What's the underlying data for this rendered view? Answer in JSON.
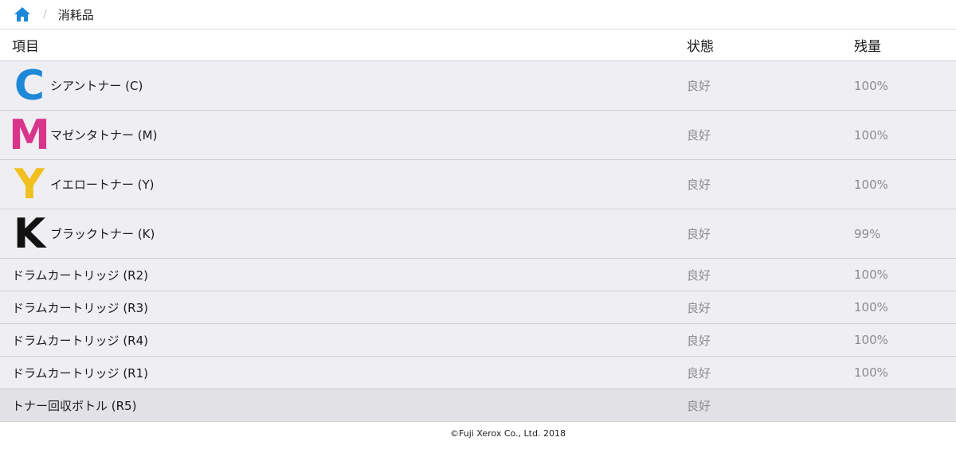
{
  "breadcrumb": {
    "home_icon": "home-icon",
    "separator": "/",
    "current": "消耗品"
  },
  "table": {
    "headers": {
      "item": "項目",
      "status": "状態",
      "level": "残量"
    },
    "rows": [
      {
        "letter": "C",
        "letter_color": "#1e88d8",
        "label": "シアントナー (C)",
        "status": "良好",
        "level": "100%"
      },
      {
        "letter": "M",
        "letter_color": "#d8358a",
        "label": "マゼンタトナー (M)",
        "status": "良好",
        "level": "100%"
      },
      {
        "letter": "Y",
        "letter_color": "#f0c020",
        "label": "イエロートナー (Y)",
        "status": "良好",
        "level": "100%"
      },
      {
        "letter": "K",
        "letter_color": "#111111",
        "label": "ブラックトナー (K)",
        "status": "良好",
        "level": "99%"
      },
      {
        "label": "ドラムカートリッジ (R2)",
        "status": "良好",
        "level": "100%"
      },
      {
        "label": "ドラムカートリッジ (R3)",
        "status": "良好",
        "level": "100%"
      },
      {
        "label": "ドラムカートリッジ (R4)",
        "status": "良好",
        "level": "100%"
      },
      {
        "label": "ドラムカートリッジ (R1)",
        "status": "良好",
        "level": "100%"
      },
      {
        "label": "トナー回収ボトル (R5)",
        "status": "良好",
        "level": ""
      }
    ]
  },
  "footer": {
    "copyright": "©Fuji Xerox Co., Ltd. 2018"
  },
  "colors": {
    "accent": "#1e88d8",
    "row_bg": "#efeef3",
    "last_row_bg": "#e2e2e6",
    "muted_text": "#8c8c8c"
  }
}
